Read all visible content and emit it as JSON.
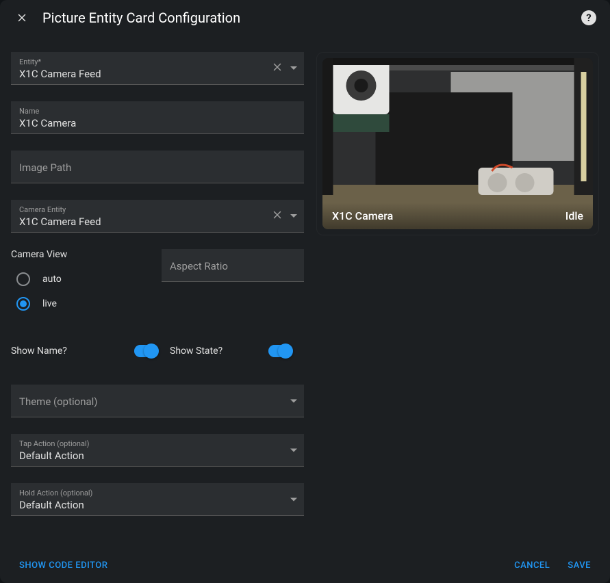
{
  "header": {
    "title": "Picture Entity Card Configuration"
  },
  "fields": {
    "entity": {
      "label": "Entity*",
      "value": "X1C Camera Feed"
    },
    "name": {
      "label": "Name",
      "value": "X1C Camera"
    },
    "image_path": {
      "label": "Image Path",
      "value": ""
    },
    "camera_entity": {
      "label": "Camera Entity",
      "value": "X1C Camera Feed"
    },
    "aspect_ratio": {
      "label": "Aspect Ratio",
      "value": ""
    },
    "theme": {
      "label": "Theme (optional)",
      "value": ""
    },
    "tap_action": {
      "label": "Tap Action (optional)",
      "value": "Default Action"
    },
    "hold_action": {
      "label": "Hold Action (optional)",
      "value": "Default Action"
    }
  },
  "camera_view": {
    "label": "Camera View",
    "options": {
      "auto": "auto",
      "live": "live"
    },
    "selected": "live"
  },
  "switches": {
    "show_name": {
      "label": "Show Name?",
      "on": true
    },
    "show_state": {
      "label": "Show State?",
      "on": true
    }
  },
  "preview": {
    "name": "X1C Camera",
    "state": "Idle"
  },
  "footer": {
    "show_code_editor": "SHOW CODE EDITOR",
    "cancel": "CANCEL",
    "save": "SAVE"
  },
  "colors": {
    "accent": "#2196f3"
  }
}
